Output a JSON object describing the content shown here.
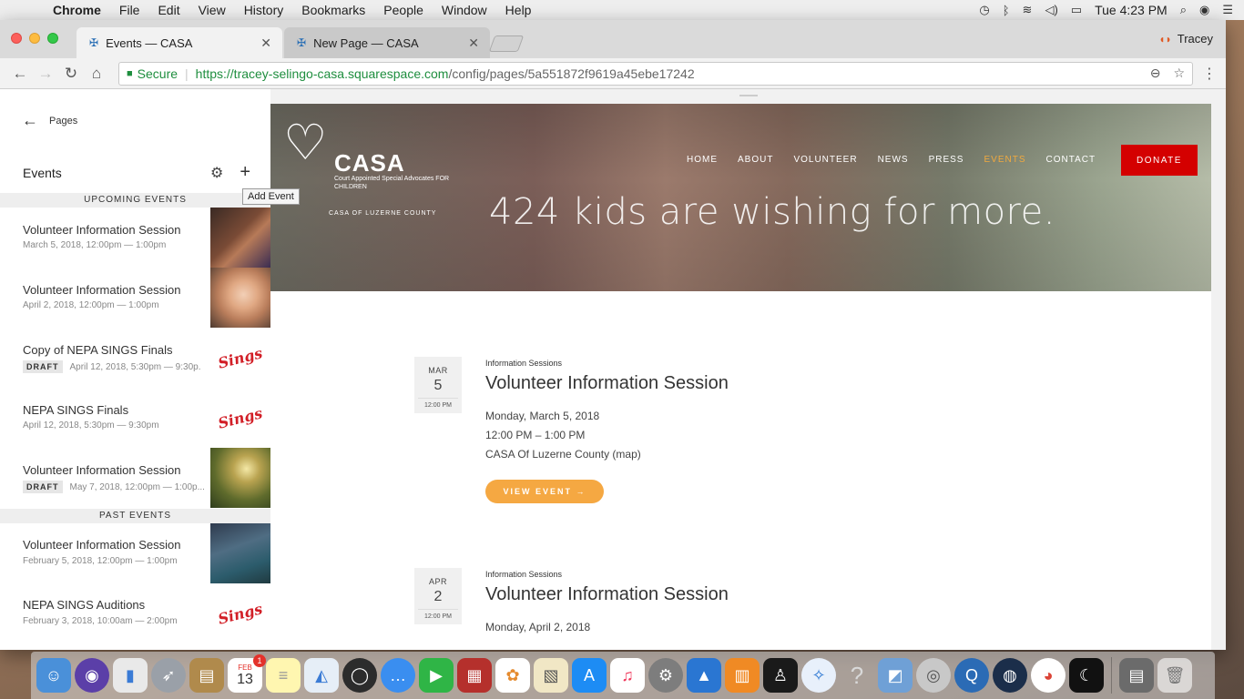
{
  "menubar": {
    "app": "Chrome",
    "items": [
      "File",
      "Edit",
      "View",
      "History",
      "Bookmarks",
      "People",
      "Window",
      "Help"
    ],
    "clock": "Tue 4:23 PM"
  },
  "browser": {
    "tabs": [
      {
        "label": "Events — CASA"
      },
      {
        "label": "New Page — CASA"
      }
    ],
    "profile": "Tracey",
    "secure_label": "Secure",
    "url_host": "https://tracey-selingo-casa.squarespace.com",
    "url_path": "/config/pages/5a551872f9619a45ebe17242"
  },
  "sidebar": {
    "back_label": "Pages",
    "section_title": "Events",
    "tooltip": "Add Event",
    "upcoming_label": "UPCOMING EVENTS",
    "past_label": "PAST EVENTS",
    "upcoming": [
      {
        "title": "Volunteer Information Session",
        "date": "March 5, 2018, 12:00pm — 1:00pm",
        "draft": ""
      },
      {
        "title": "Volunteer Information Session",
        "date": "April 2, 2018, 12:00pm — 1:00pm",
        "draft": ""
      },
      {
        "title": "Copy of NEPA SINGS Finals",
        "date": "April 12, 2018, 5:30pm — 9:30p.",
        "draft": "DRAFT"
      },
      {
        "title": "NEPA SINGS Finals",
        "date": "April 12, 2018, 5:30pm — 9:30pm",
        "draft": ""
      },
      {
        "title": "Volunteer Information Session",
        "date": "May 7, 2018, 12:00pm — 1:00p...",
        "draft": "DRAFT"
      }
    ],
    "past": [
      {
        "title": "Volunteer Information Session",
        "date": "February 5, 2018, 12:00pm — 1:00pm"
      },
      {
        "title": "NEPA SINGS Auditions",
        "date": "February 3, 2018, 10:00am — 2:00pm"
      }
    ],
    "sings_logo": "Sings"
  },
  "site": {
    "logo_name": "CASA",
    "logo_sub": "Court Appointed Special Advocates FOR CHILDREN",
    "logo_county": "CASA OF LUZERNE COUNTY",
    "nav": [
      "HOME",
      "ABOUT",
      "VOLUNTEER",
      "NEWS",
      "PRESS",
      "EVENTS",
      "CONTACT"
    ],
    "donate": "DONATE",
    "headline": "424 kids are wishing for more.",
    "events": [
      {
        "month": "MAR",
        "day": "5",
        "time": "12:00 PM",
        "category": "Information Sessions",
        "title": "Volunteer Information Session",
        "date_line": "Monday, March 5, 2018",
        "time_line": "12:00 PM – 1:00 PM",
        "location": "CASA Of Luzerne County (map)",
        "button": "VIEW EVENT →"
      },
      {
        "month": "APR",
        "day": "2",
        "time": "12:00 PM",
        "category": "Information Sessions",
        "title": "Volunteer Information Session",
        "date_line": "Monday, April 2, 2018"
      }
    ]
  },
  "dock": {
    "calendar_month": "FEB",
    "calendar_day": "13",
    "calendar_badge": "1"
  },
  "colors": {
    "accent_orange": "#f5a842",
    "donate_red": "#d40000",
    "nav_active": "#f0a93f",
    "secure_green": "#1e8e3e"
  }
}
